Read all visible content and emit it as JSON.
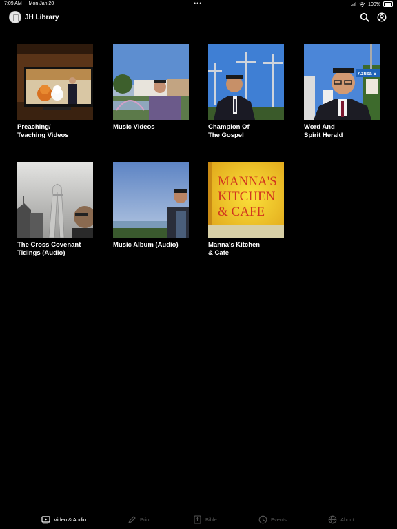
{
  "status": {
    "time": "7:09 AM",
    "date": "Mon Jan 20",
    "battery": "100%"
  },
  "header": {
    "title": "JH Library"
  },
  "tiles": [
    {
      "label": "Preaching/\nTeaching Videos"
    },
    {
      "label": "Music Videos"
    },
    {
      "label": "Champion Of\nThe Gospel"
    },
    {
      "label": "Word And\nSpirit Herald"
    },
    {
      "label": "The Cross Covenant\nTidings (Audio)"
    },
    {
      "label": "Music Album (Audio)"
    },
    {
      "label": "Manna's Kitchen\n& Cafe",
      "sign_text": "MANNA'S KITCHEN & CAFE"
    }
  ],
  "street_sign": "Azusa S",
  "tabs": [
    {
      "label": "Video & Audio",
      "icon": "video-icon",
      "active": true
    },
    {
      "label": "Print",
      "icon": "pen-icon",
      "active": false
    },
    {
      "label": "Bible",
      "icon": "book-icon",
      "active": false
    },
    {
      "label": "Events",
      "icon": "clock-icon",
      "active": false
    },
    {
      "label": "About",
      "icon": "globe-icon",
      "active": false
    }
  ],
  "colors": {
    "background": "#000000",
    "active_tab": "#ffffff",
    "inactive_tab": "#555555"
  }
}
